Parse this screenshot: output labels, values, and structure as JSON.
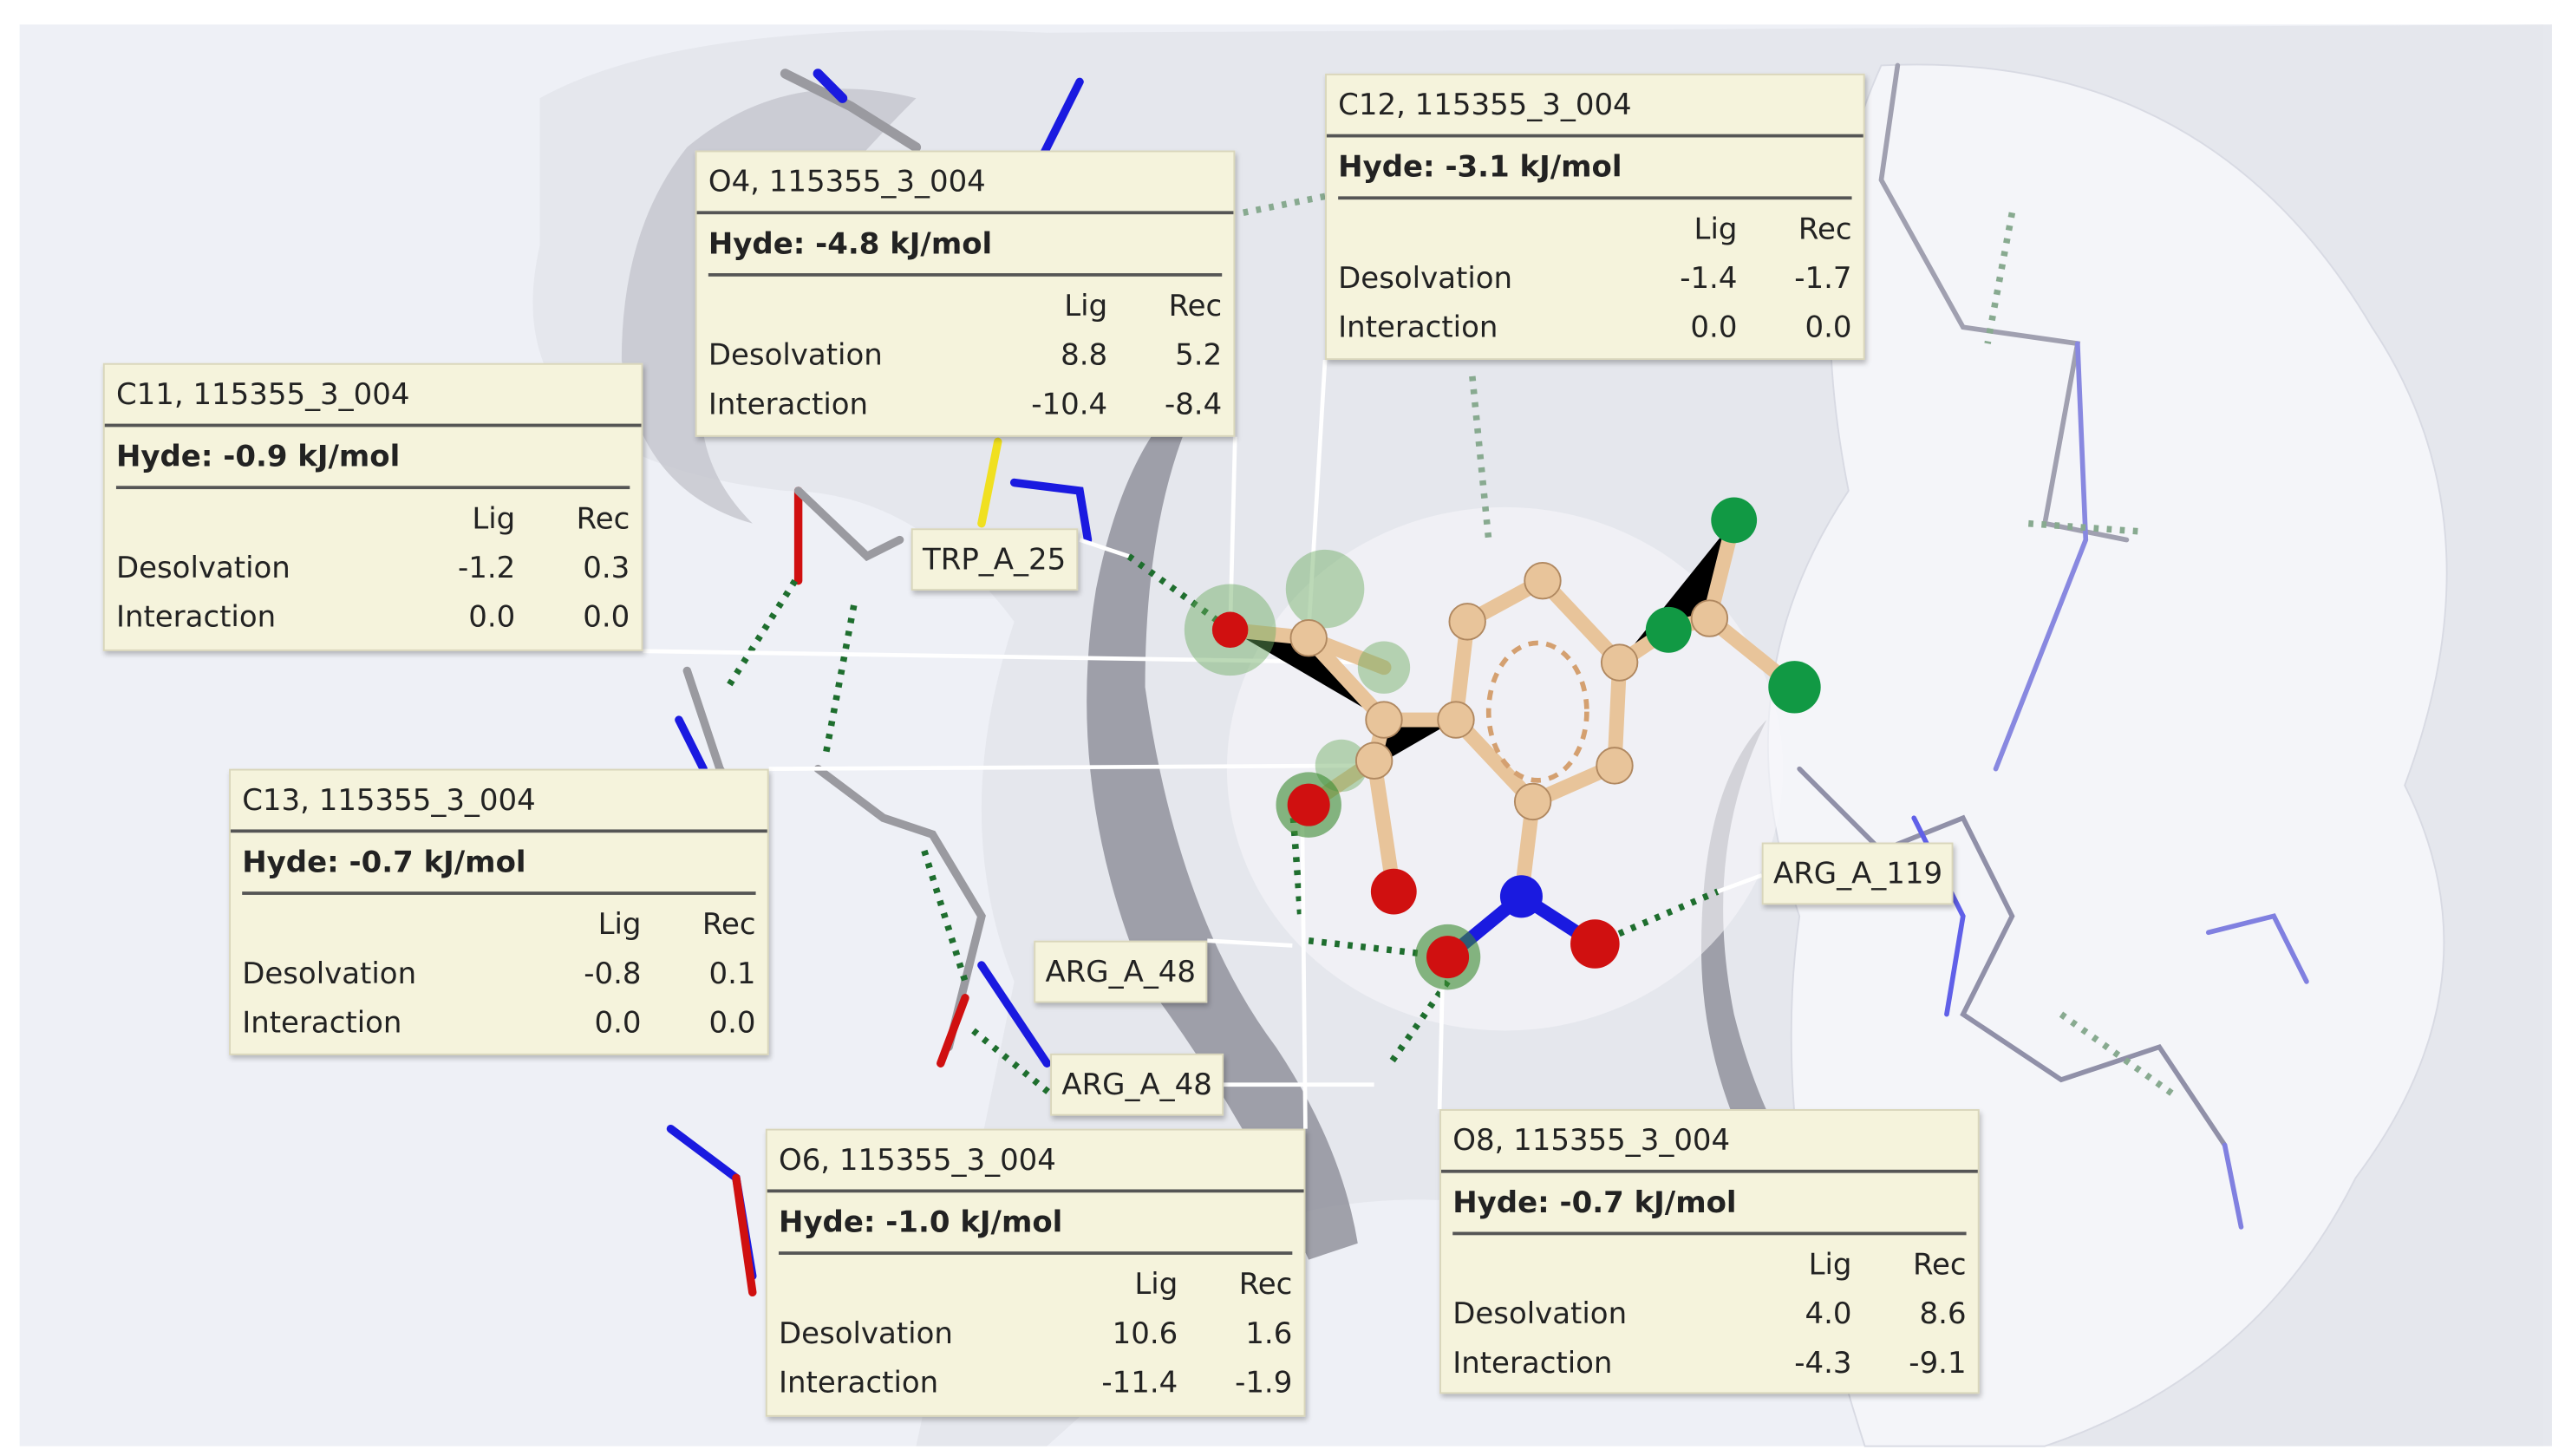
{
  "atom_panels": [
    {
      "title": "C11, 115355_3_004",
      "hyde": "Hyde: -0.9 kJ/mol",
      "col_lig": "Lig",
      "col_rec": "Rec",
      "rows": [
        {
          "label": "Desolvation",
          "lig": "-1.2",
          "rec": "0.3"
        },
        {
          "label": "Interaction",
          "lig": "0.0",
          "rec": "0.0"
        }
      ]
    },
    {
      "title": "O4, 115355_3_004",
      "hyde": "Hyde: -4.8 kJ/mol",
      "col_lig": "Lig",
      "col_rec": "Rec",
      "rows": [
        {
          "label": "Desolvation",
          "lig": "8.8",
          "rec": "5.2"
        },
        {
          "label": "Interaction",
          "lig": "-10.4",
          "rec": "-8.4"
        }
      ]
    },
    {
      "title": "C12, 115355_3_004",
      "hyde": "Hyde: -3.1 kJ/mol",
      "col_lig": "Lig",
      "col_rec": "Rec",
      "rows": [
        {
          "label": "Desolvation",
          "lig": "-1.4",
          "rec": "-1.7"
        },
        {
          "label": "Interaction",
          "lig": "0.0",
          "rec": "0.0"
        }
      ]
    },
    {
      "title": "C13, 115355_3_004",
      "hyde": "Hyde: -0.7 kJ/mol",
      "col_lig": "Lig",
      "col_rec": "Rec",
      "rows": [
        {
          "label": "Desolvation",
          "lig": "-0.8",
          "rec": "0.1"
        },
        {
          "label": "Interaction",
          "lig": "0.0",
          "rec": "0.0"
        }
      ]
    },
    {
      "title": "O6, 115355_3_004",
      "hyde": "Hyde: -1.0 kJ/mol",
      "col_lig": "Lig",
      "col_rec": "Rec",
      "rows": [
        {
          "label": "Desolvation",
          "lig": "10.6",
          "rec": "1.6"
        },
        {
          "label": "Interaction",
          "lig": "-11.4",
          "rec": "-1.9"
        }
      ]
    },
    {
      "title": "O8, 115355_3_004",
      "hyde": "Hyde: -0.7 kJ/mol",
      "col_lig": "Lig",
      "col_rec": "Rec",
      "rows": [
        {
          "label": "Desolvation",
          "lig": "4.0",
          "rec": "8.6"
        },
        {
          "label": "Interaction",
          "lig": "-4.3",
          "rec": "-9.1"
        }
      ]
    }
  ],
  "residue_labels": [
    "TRP_A_25",
    "ARG_A_48",
    "ARG_A_48",
    "ARG_A_119"
  ],
  "colors": {
    "panel_bg": "#f5f3dc",
    "carbon": "#e8c49a",
    "oxygen": "#d01010",
    "nitrogen": "#1a1ae0",
    "hbond": "#1e6e2e",
    "surface": "#e6e8ef"
  }
}
